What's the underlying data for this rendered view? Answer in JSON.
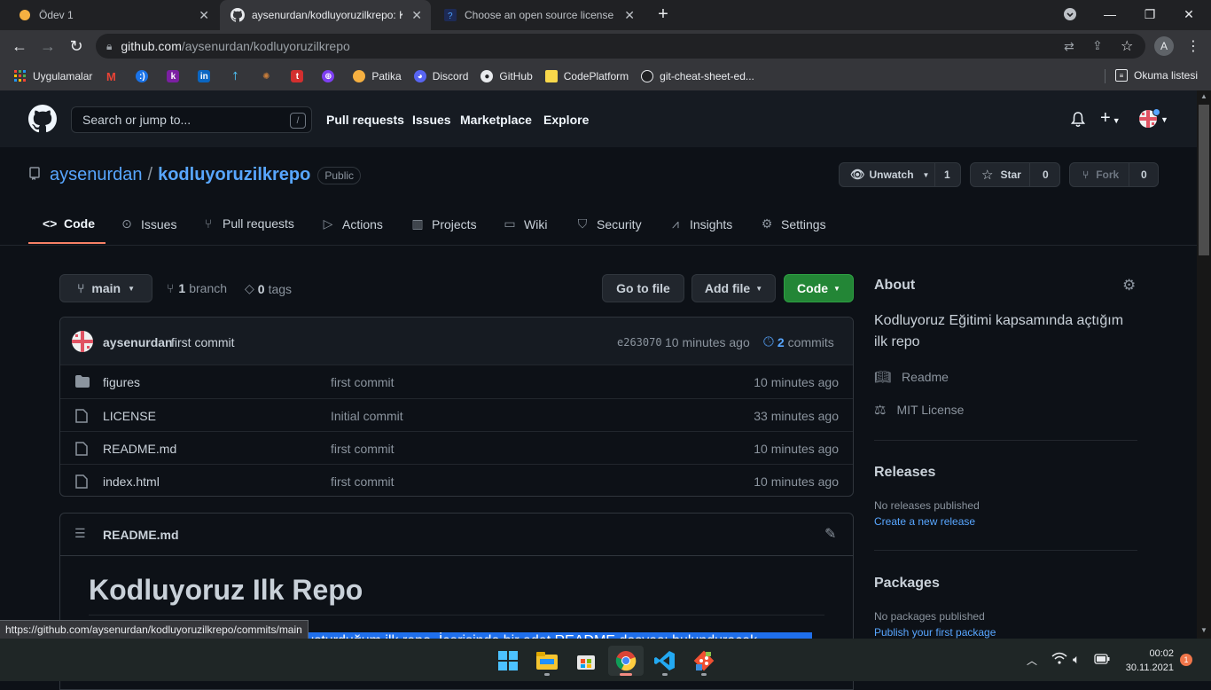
{
  "browser": {
    "tabs": [
      {
        "title": "Ödev 1",
        "icon": "patika-icon",
        "active": false
      },
      {
        "title": "aysenurdan/kodluyoruzilkrepo: K",
        "icon": "github-icon",
        "active": true
      },
      {
        "title": "Choose an open source license | ",
        "icon": "help-icon",
        "active": false
      }
    ],
    "new_tab": "+",
    "url_host": "github.com",
    "url_path": "/aysenurdan/kodluyoruzilkrepo",
    "profile_initial": "A",
    "bookmarks": [
      {
        "label": "Uygulamalar",
        "icon": "apps-icon"
      },
      {
        "label": "",
        "icon": "gmail-icon"
      },
      {
        "label": "",
        "icon": "bookmark-icon"
      },
      {
        "label": "",
        "icon": "k-icon"
      },
      {
        "label": "",
        "icon": "linkedin-icon"
      },
      {
        "label": "",
        "icon": "bookmark-icon"
      },
      {
        "label": "",
        "icon": "bookmark-icon"
      },
      {
        "label": "",
        "icon": "t-icon"
      },
      {
        "label": "",
        "icon": "bookmark-icon"
      },
      {
        "label": "Patika",
        "icon": "patika-icon"
      },
      {
        "label": "Discord",
        "icon": "discord-icon"
      },
      {
        "label": "GitHub",
        "icon": "github-icon"
      },
      {
        "label": "CodePlatform",
        "icon": "folder-icon"
      },
      {
        "label": "git-cheat-sheet-ed...",
        "icon": "github-icon"
      }
    ],
    "reading_list": "Okuma listesi",
    "status_url": "https://github.com/aysenurdan/kodluyoruzilkrepo/commits/main"
  },
  "header": {
    "search_placeholder": "Search or jump to...",
    "search_key": "/",
    "nav": [
      "Pull requests",
      "Issues",
      "Marketplace",
      "Explore"
    ]
  },
  "repo": {
    "owner": "aysenurdan",
    "sep": "/",
    "name": "kodluyoruzilkrepo",
    "visibility": "Public",
    "unwatch": "Unwatch",
    "watch_count": "1",
    "star": "Star",
    "star_count": "0",
    "fork": "Fork",
    "fork_count": "0",
    "tabs": [
      "Code",
      "Issues",
      "Pull requests",
      "Actions",
      "Projects",
      "Wiki",
      "Security",
      "Insights",
      "Settings"
    ]
  },
  "toolbar": {
    "branch": "main",
    "branch_count": "1",
    "branch_label": "branch",
    "tag_count": "0",
    "tag_label": "tags",
    "goto_file": "Go to file",
    "add_file": "Add file",
    "code": "Code"
  },
  "commit": {
    "author": "aysenurdan",
    "message": "first commit",
    "sha": "e263070",
    "age": "10 minutes ago",
    "count": "2",
    "count_label": "commits"
  },
  "files": [
    {
      "name": "figures",
      "type": "folder",
      "message": "first commit",
      "age": "10 minutes ago"
    },
    {
      "name": "LICENSE",
      "type": "file",
      "message": "Initial commit",
      "age": "33 minutes ago"
    },
    {
      "name": "README.md",
      "type": "file",
      "message": "first commit",
      "age": "10 minutes ago"
    },
    {
      "name": "index.html",
      "type": "file",
      "message": "first commit",
      "age": "10 minutes ago"
    }
  ],
  "readme": {
    "filename": "README.md",
    "heading": "Kodluyoruz Ilk Repo",
    "selected_text": "Kodluyoruz Eğitimi kapsamında, oluşturduğum ilk repo. İçerisinde bir adet README dosyası bulunduracak"
  },
  "about": {
    "title": "About",
    "description": "Kodluyoruz Eğitimi kapsamında açtığım ilk repo",
    "readme": "Readme",
    "license": "MIT License",
    "releases_title": "Releases",
    "releases_none": "No releases published",
    "releases_link": "Create a new release",
    "packages_title": "Packages",
    "packages_none": "No packages published",
    "packages_link": "Publish your first package"
  },
  "taskbar": {
    "time": "00:02",
    "date": "30.11.2021",
    "notif": "1"
  },
  "colors": {
    "link": "#58a6ff",
    "primary_btn": "#238636",
    "active_tab_underline": "#f78166"
  }
}
